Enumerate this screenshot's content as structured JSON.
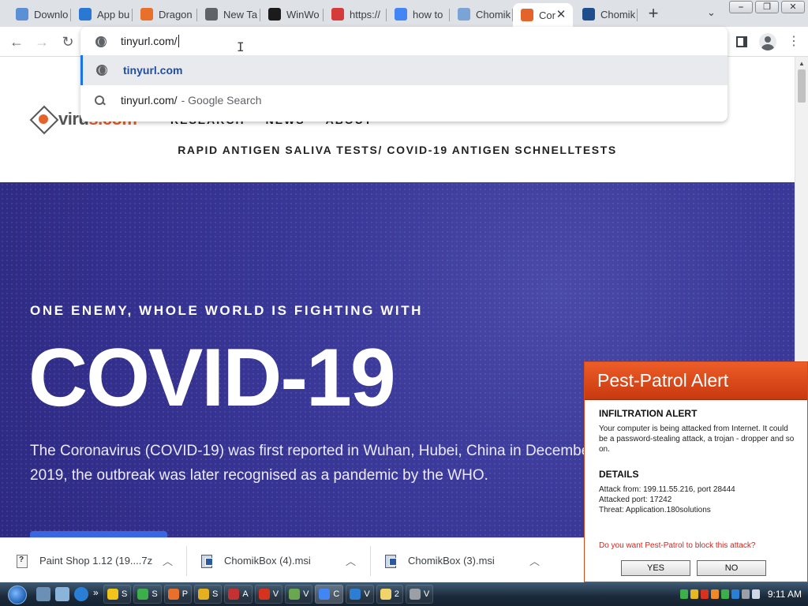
{
  "browser": {
    "tabs": [
      {
        "label": "Downlo",
        "icon": "tab-favicon-download",
        "color": "#5b8fd6"
      },
      {
        "label": "App bu",
        "icon": "tab-favicon-appbuilder",
        "color": "#2a78d4"
      },
      {
        "label": "Dragon",
        "icon": "tab-favicon-dragon",
        "color": "#e8702a"
      },
      {
        "label": "New Ta",
        "icon": "tab-favicon-chrome",
        "color": "#5f6368"
      },
      {
        "label": "WinWo",
        "icon": "tab-favicon-winworld",
        "color": "#1b1b1b"
      },
      {
        "label": "https://",
        "icon": "tab-favicon-redcross",
        "color": "#d63b3b"
      },
      {
        "label": "how to",
        "icon": "tab-favicon-google",
        "color": "#4285f4"
      },
      {
        "label": "Chomik",
        "icon": "tab-favicon-chomik",
        "color": "#7aa3d6"
      },
      {
        "label": "Cor",
        "icon": "tab-favicon-virus",
        "color": "#e4632b",
        "active": true
      },
      {
        "label": "Chomik",
        "icon": "tab-favicon-chomikbox",
        "color": "#1e4e8c"
      }
    ],
    "new_tab_symbol": "+",
    "tab_menu_symbol": "⌄",
    "window_buttons": [
      "⎯",
      "❐",
      "✕"
    ],
    "omnibox": {
      "typed_text": "tinyurl.com/",
      "suggestions": [
        {
          "text": "tinyurl.com",
          "sub": "",
          "kind": "url",
          "selected": true
        },
        {
          "text": "tinyurl.com/",
          "sub": "- Google Search",
          "kind": "search",
          "selected": false
        }
      ]
    }
  },
  "page": {
    "logo_text_a": "viru",
    "logo_text_b": "s.com",
    "nav": [
      "RESEARCH",
      "NEWS",
      "ABOUT"
    ],
    "subtitle": "RAPID ANTIGEN SALIVA TESTS/ COVID-19 ANTIGEN SCHNELLTESTS",
    "hero": {
      "kicker": "ONE ENEMY, WHOLE WORLD IS FIGHTING WITH",
      "headline": "COVID-19",
      "paragraph": "The Coronavirus (COVID-19) was first reported in Wuhan, Hubei, China in December 2019, the outbreak was later recognised as a pandemic by the WHO."
    }
  },
  "downloads": [
    {
      "name": "Paint Shop 1.12 (19....7z",
      "type": "archive"
    },
    {
      "name": "ChomikBox (4).msi",
      "type": "msi"
    },
    {
      "name": "ChomikBox (3).msi",
      "type": "msi"
    }
  ],
  "popup": {
    "title": "Pest-Patrol Alert",
    "alert_heading": "INFILTRATION ALERT",
    "alert_text": "Your computer is being attacked from Internet. It could be a password-stealing attack, a trojan - dropper and so on.",
    "details_heading": "DETAILS",
    "attack_from": "Attack from: 199.11.55.216, port 28444",
    "attacked_port": "Attacked port: 17242",
    "threat": "Threat: Application.180solutions",
    "question": "Do you want Pest-Patrol to block this attack?",
    "yes_label": "YES",
    "no_label": "NO"
  },
  "taskbar": {
    "items": [
      {
        "label": "S",
        "color": "#f0c419"
      },
      {
        "label": "S",
        "color": "#3cae4a"
      },
      {
        "label": "P",
        "color": "#e8702a"
      },
      {
        "label": "S",
        "color": "#e4b020"
      },
      {
        "label": "A",
        "color": "#c43131"
      },
      {
        "label": "V",
        "color": "#d6321e"
      },
      {
        "label": "V",
        "color": "#6aa84f"
      },
      {
        "label": "C",
        "color": "#4285f4",
        "active": true
      },
      {
        "label": "V",
        "color": "#2d7dd2"
      },
      {
        "label": "2",
        "color": "#f0d36a"
      },
      {
        "label": "V",
        "color": "#9aa0a6"
      }
    ],
    "clock": "9:11 AM"
  },
  "colors": {
    "accent": "#1a73e8",
    "hero_bg": "#3b3a9a",
    "popup_header": "#e04e1c",
    "popup_question": "#d4241c"
  }
}
